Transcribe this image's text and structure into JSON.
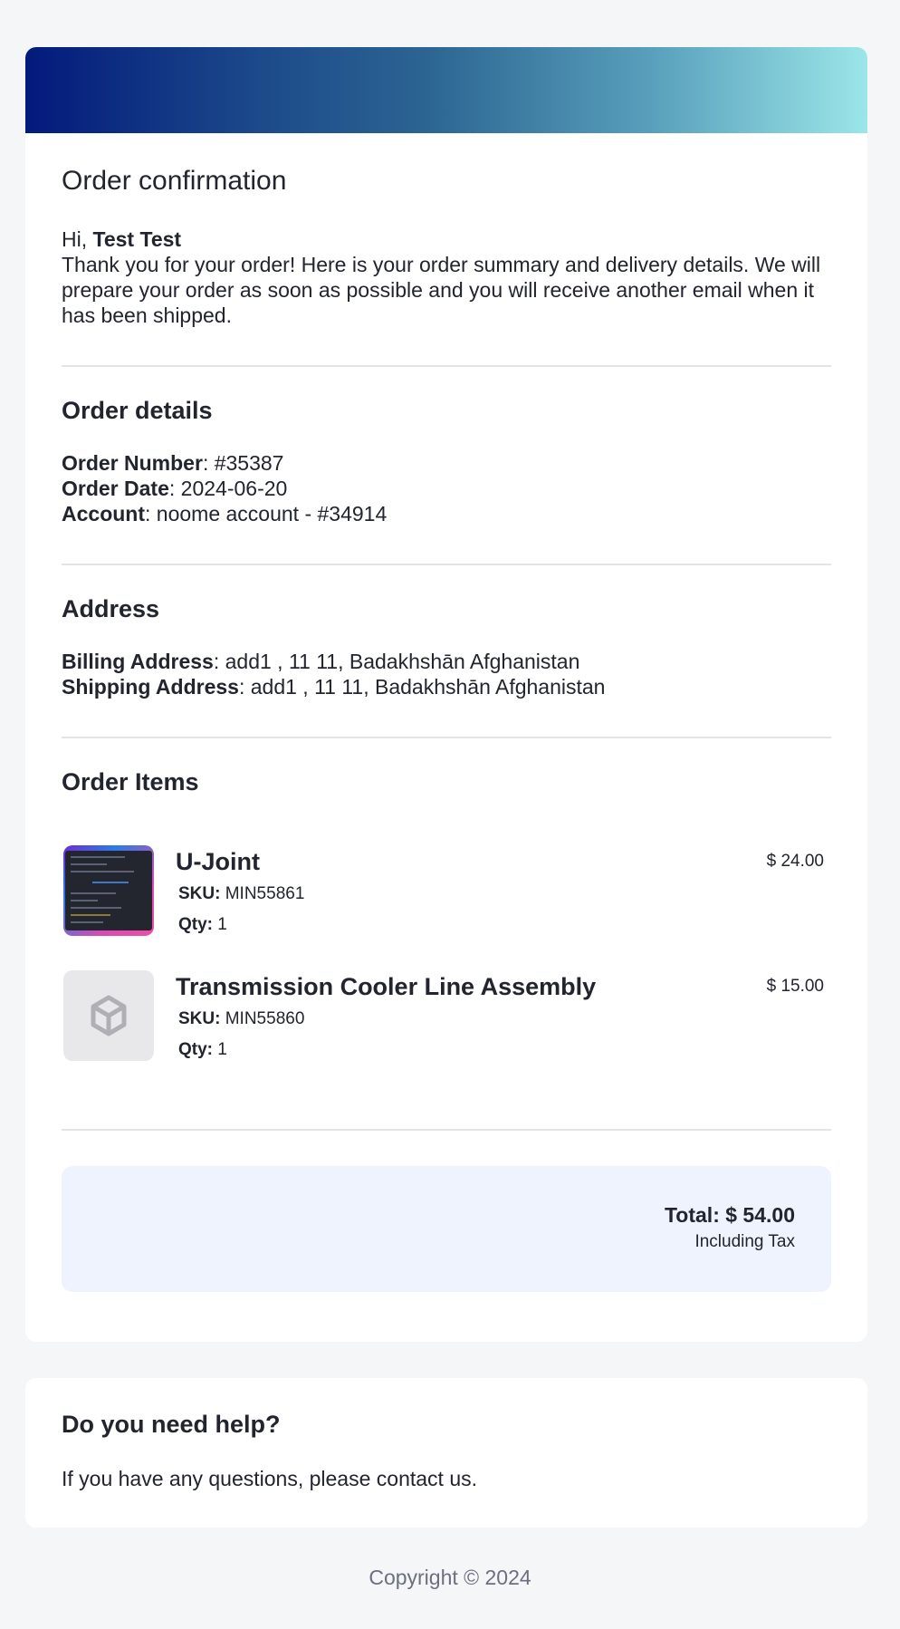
{
  "header": {
    "title": "Order confirmation"
  },
  "greeting": {
    "prefix": "Hi, ",
    "name": "Test Test",
    "message": "Thank you for your order! Here is your order summary and delivery details. We will prepare your order as soon as possible and you will receive another email when it has been shipped."
  },
  "order_details": {
    "heading": "Order details",
    "number_label": "Order Number",
    "number_value": ": #35387",
    "date_label": "Order Date",
    "date_value": ": 2024-06-20",
    "account_label": "Account",
    "account_value": ": noome account - #34914"
  },
  "address": {
    "heading": "Address",
    "billing_label": "Billing Address",
    "billing_value": ": add1 , 11 11, Badakhshān Afghanistan",
    "shipping_label": "Shipping Address",
    "shipping_value": ": add1 , 11 11, Badakhshān Afghanistan"
  },
  "order_items": {
    "heading": "Order Items",
    "sku_label": "SKU:",
    "qty_label": "Qty:",
    "items": [
      {
        "name": "U-Joint",
        "sku": "MIN55861",
        "qty": "1",
        "price": "$ 24.00",
        "image": "product-screenshot-thumbnail"
      },
      {
        "name": "Transmission Cooler Line Assembly",
        "sku": "MIN55860",
        "qty": "1",
        "price": "$ 15.00",
        "image": "box-placeholder-icon"
      }
    ]
  },
  "totals": {
    "total": "Total: $ 54.00",
    "tax_note": "Including Tax"
  },
  "help": {
    "heading": "Do you need help?",
    "text": "If you have any questions, please contact us."
  },
  "footer": {
    "copyright": "Copyright © 2024"
  },
  "colors": {
    "page_background": "#f5f6f8",
    "text": "#22242e",
    "total_box_background": "#eef3fd",
    "banner_start": "#031a7c",
    "banner_end": "#9be6e8"
  }
}
